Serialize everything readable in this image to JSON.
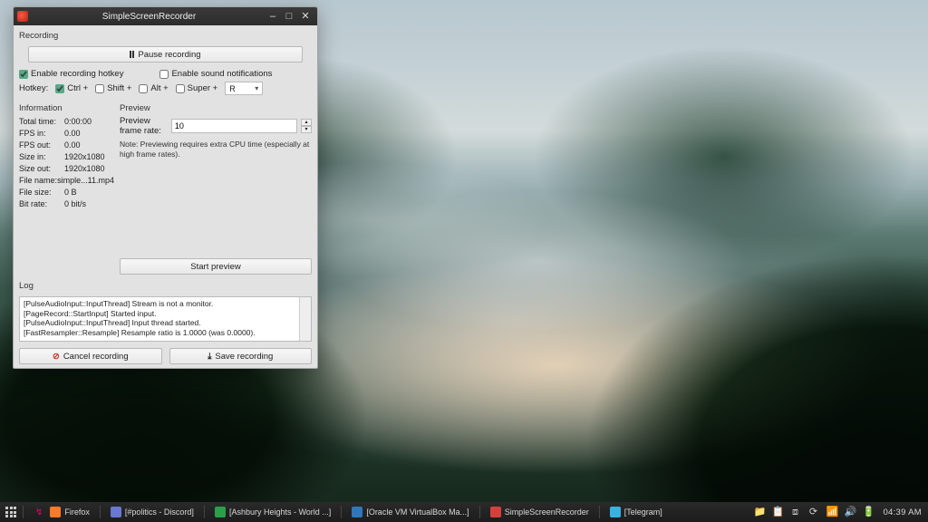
{
  "window": {
    "title": "SimpleScreenRecorder",
    "recording_section": "Recording",
    "pause_btn": "Pause recording",
    "enable_hotkey": "Enable recording hotkey",
    "enable_sound": "Enable sound notifications",
    "hotkey_label": "Hotkey:",
    "mods": {
      "ctrl": "Ctrl +",
      "shift": "Shift +",
      "alt": "Alt +",
      "super": "Super +"
    },
    "hotkey_key": "R",
    "info_section": "Information",
    "preview_section": "Preview",
    "info": [
      {
        "k": "Total time:",
        "v": "0:00:00"
      },
      {
        "k": "FPS in:",
        "v": "0.00"
      },
      {
        "k": "FPS out:",
        "v": "0.00"
      },
      {
        "k": "Size in:",
        "v": "1920x1080"
      },
      {
        "k": "Size out:",
        "v": "1920x1080"
      },
      {
        "k": "File name:",
        "v": "simple...11.mp4"
      },
      {
        "k": "File size:",
        "v": "0 B"
      },
      {
        "k": "Bit rate:",
        "v": "0 bit/s"
      }
    ],
    "preview_rate_label": "Preview frame rate:",
    "preview_rate_value": "10",
    "preview_note": "Note: Previewing requires extra CPU time (especially at high frame rates).",
    "start_preview_btn": "Start preview",
    "log_section": "Log",
    "log_lines": [
      "[PulseAudioInput::InputThread] Stream is not a monitor.",
      "[PageRecord::StartInput] Started input.",
      "[PulseAudioInput::InputThread] Input thread started.",
      "[FastResampler::Resample] Resample ratio is 1.0000 (was 0.0000)."
    ],
    "cancel_btn": "Cancel recording",
    "save_btn": "Save recording"
  },
  "taskbar": {
    "items": [
      {
        "icon": "#ff7a29",
        "label": "Firefox"
      },
      {
        "icon": "#6a78d1",
        "label": "[#politics - Discord]"
      },
      {
        "icon": "#2aa04a",
        "label": "[Ashbury Heights - World ...]"
      },
      {
        "icon": "#2e77bb",
        "label": "[Oracle VM VirtualBox Ma...]"
      },
      {
        "icon": "#d6403a",
        "label": "SimpleScreenRecorder"
      },
      {
        "icon": "#38b3e0",
        "label": "[Telegram]"
      }
    ],
    "clock": "04:39 AM"
  }
}
